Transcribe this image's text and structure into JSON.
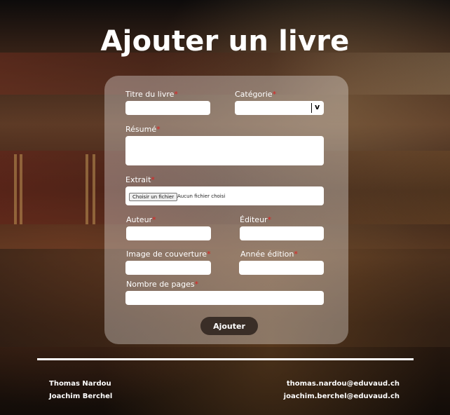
{
  "header": {
    "title": "Ajouter un livre"
  },
  "form": {
    "title_label": "Titre du livre",
    "title_value": "",
    "category_label": "Catégorie",
    "category_selected": "",
    "category_chevron": "v",
    "summary_label": "Résumé",
    "summary_value": "",
    "extract_label": "Extrait",
    "file_button": "Choisir un fichier",
    "file_status": "Aucun fichier choisi",
    "author_label": "Auteur",
    "author_value": "",
    "publisher_label": "Éditeur",
    "publisher_value": "",
    "cover_label": "Image de couverture",
    "cover_value": "",
    "year_label": "Année édition",
    "year_value": "",
    "pages_label": "Nombre de pages",
    "pages_value": "",
    "required_mark": "*",
    "submit_label": "Ajouter"
  },
  "footer": {
    "authors": [
      "Thomas Nardou",
      "Joachim Berchel"
    ],
    "emails": [
      "thomas.nardou@eduvaud.ch",
      "joachim.berchel@eduvaud.ch"
    ]
  },
  "colors": {
    "required": "#e02020",
    "button": "#3a2e27",
    "card": "rgba(255,255,255,0.32)"
  }
}
